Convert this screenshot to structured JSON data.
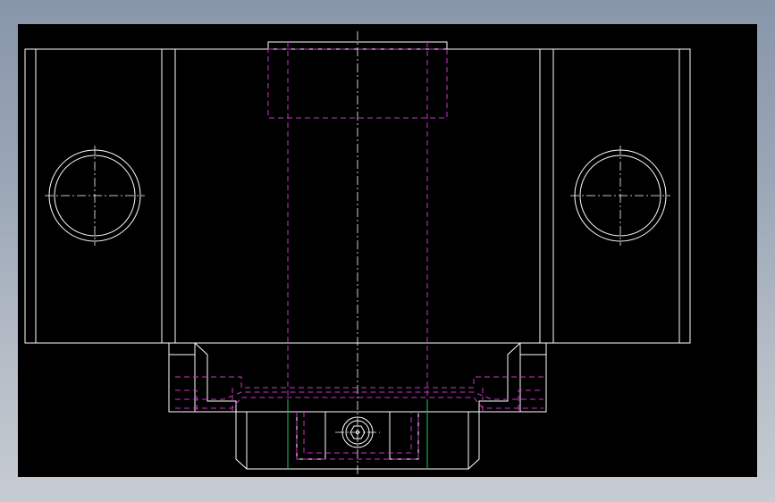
{
  "viewport": {
    "background": "#000000"
  },
  "colors": {
    "outline": "#ffffff",
    "hidden": "#cc33cc",
    "center": "#ffffff",
    "accent": "#22c55e"
  },
  "drawing": {
    "view": "front-elevation",
    "line_types": [
      "solid-outline",
      "hidden-dashed",
      "center-dashdot"
    ],
    "features": [
      "left-hole",
      "right-hole",
      "central-bore",
      "hex-socket-screw"
    ]
  }
}
